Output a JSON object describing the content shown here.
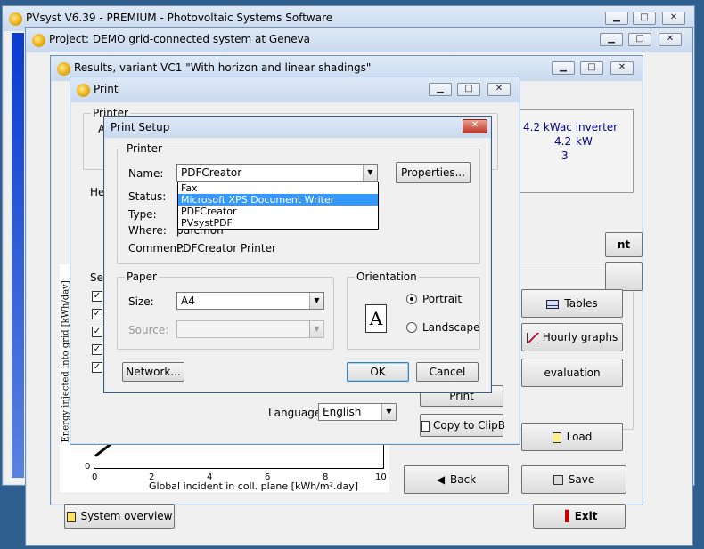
{
  "main_window": {
    "title": "PVsyst V6.39 - PREMIUM - Photovoltaic Systems Software"
  },
  "project_window": {
    "title": "Project:  DEMO grid-connected system at Geneva"
  },
  "results_window": {
    "title": "Results, variant VC1  \"With horizon and linear shadings\"",
    "system_info": {
      "inverter": "4.2 kWac inverter",
      "power_value": "4.2",
      "power_unit": "kW",
      "count": "3"
    },
    "buttons": {
      "tables": "Tables",
      "hourly_graphs": "Hourly graphs",
      "evaluation": "evaluation",
      "load": "Load",
      "back": "Back",
      "save": "Save",
      "exit": "Exit",
      "system_overview": "System overview",
      "nt_fragment": "nt",
      "help": "?"
    },
    "chart": {
      "ylabel": "Energy  injected into grid [kWh/day]",
      "xlabel": "Global incident in coll. plane [kWh/m².day]",
      "x_ticks": [
        "0",
        "2",
        "4",
        "6",
        "8",
        "10"
      ],
      "y_tick": "0"
    }
  },
  "print_window": {
    "title": "Print",
    "printer_group": "Printer",
    "printer_letter": "A",
    "header_fragment": "He",
    "select_fragment": "Sel",
    "print_fragment": "Print",
    "copy_to_clipboard": "Copy to ClipB",
    "language_label": "Language",
    "language_value": "English"
  },
  "print_setup": {
    "title": "Print Setup",
    "printer_group": "Printer",
    "name_label": "Name:",
    "name_value": "PDFCreator",
    "properties_button": "Properties...",
    "status_label": "Status:",
    "type_label": "Type:",
    "where_label": "Where:",
    "where_value": "pdfcmon",
    "comment_label": "Comment:",
    "comment_value": "PDFCreator Printer",
    "printer_options": [
      "Fax",
      "Microsoft XPS Document Writer",
      "PDFCreator",
      "PVsystPDF"
    ],
    "paper_group": "Paper",
    "size_label": "Size:",
    "size_value": "A4",
    "source_label": "Source:",
    "source_value": "",
    "orientation_group": "Orientation",
    "portrait_label": "Portrait",
    "landscape_label": "Landscape",
    "orientation_icon": "A",
    "network_button": "Network...",
    "ok_button": "OK",
    "cancel_button": "Cancel",
    "close_glyph": "✕"
  }
}
